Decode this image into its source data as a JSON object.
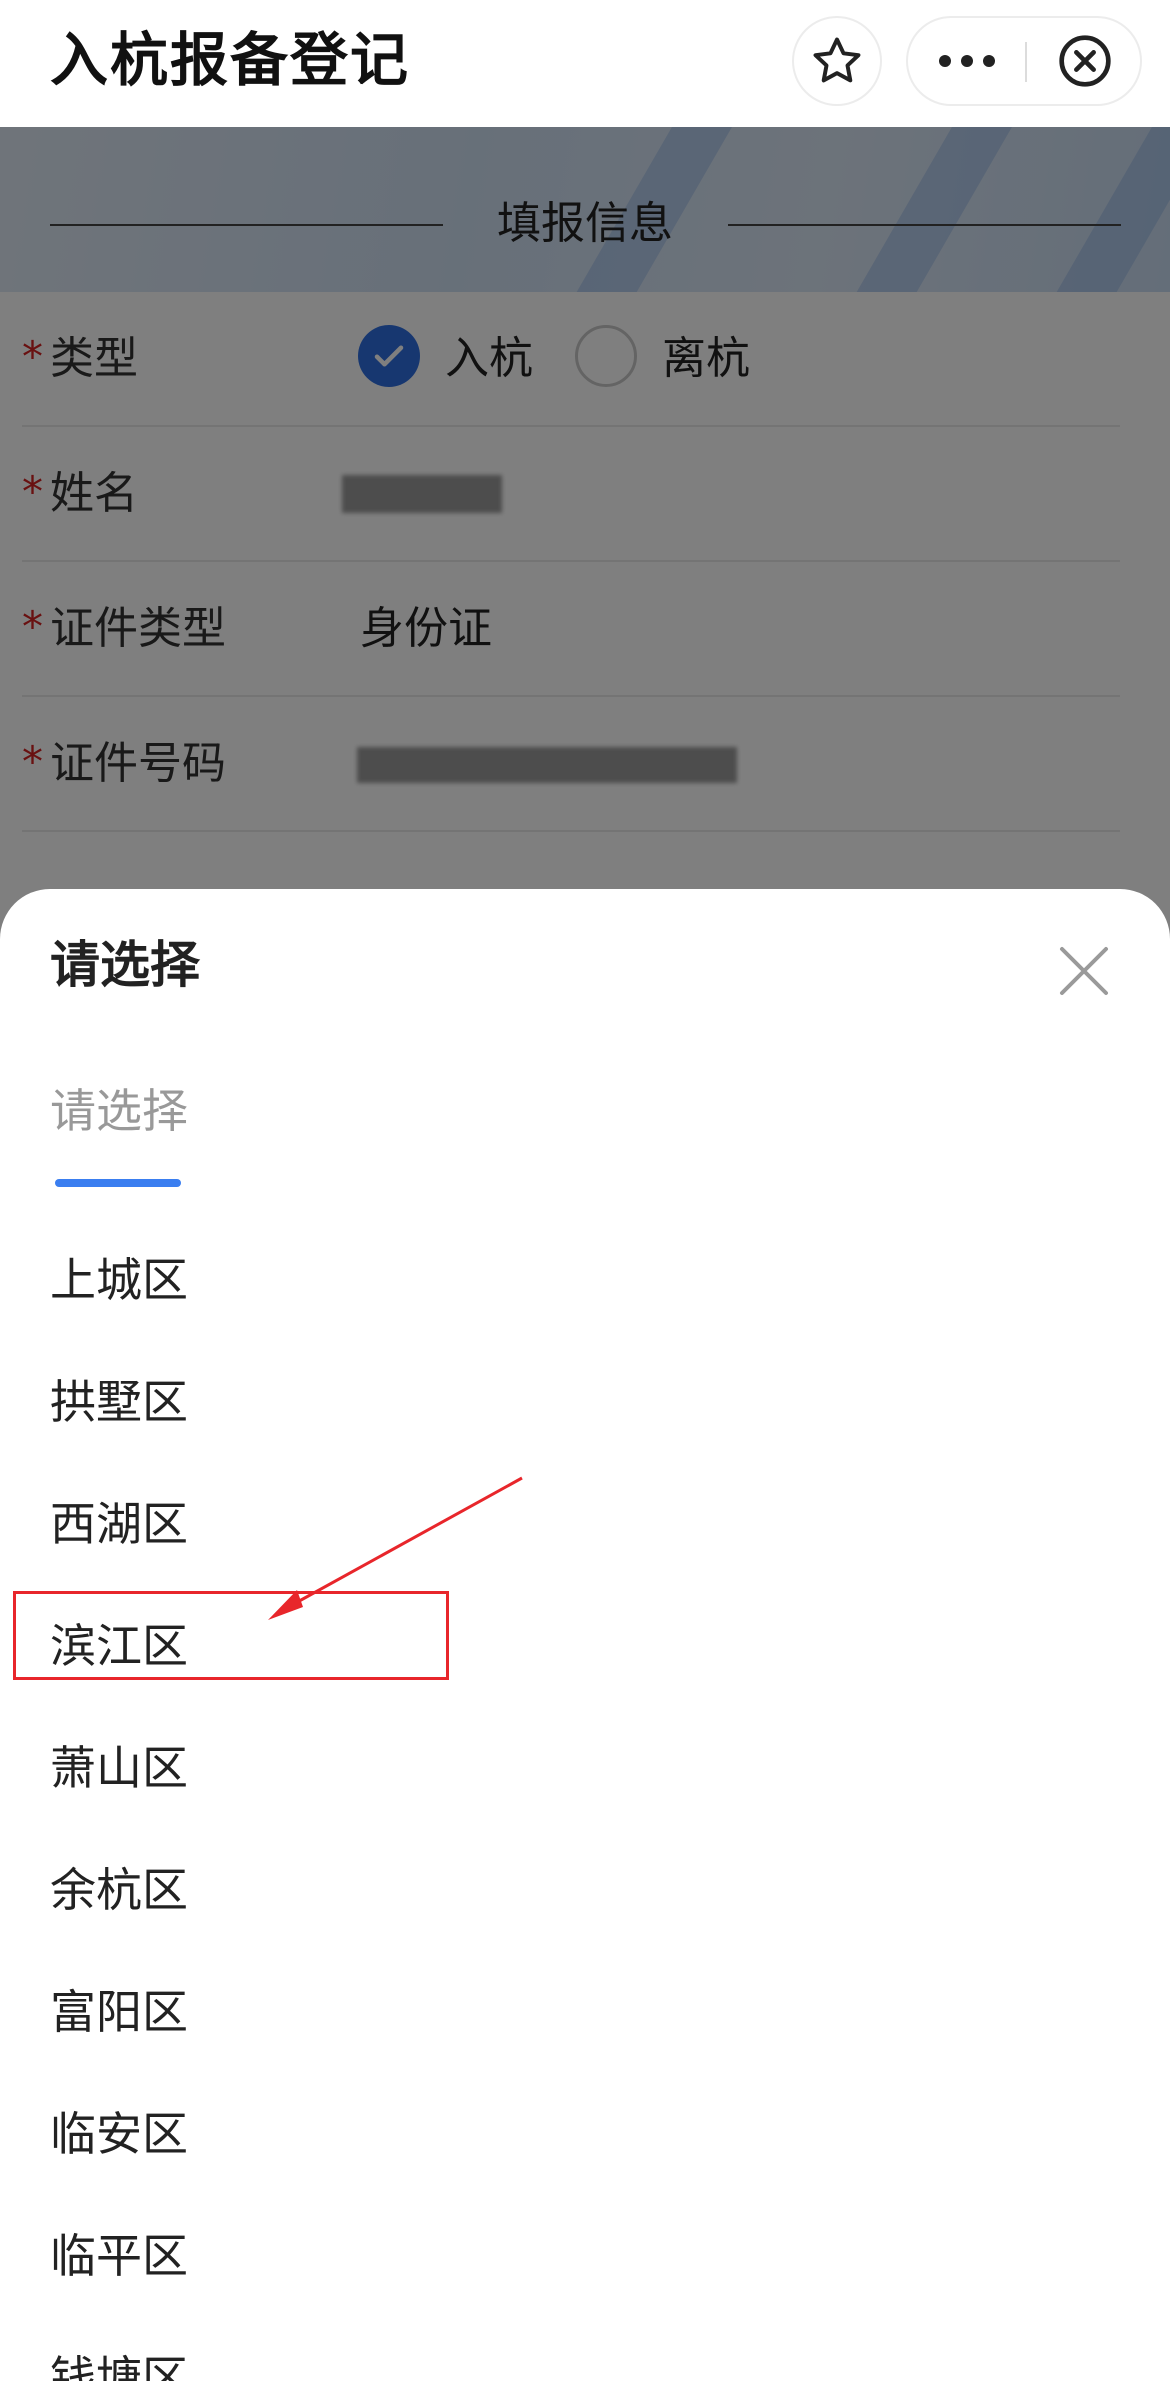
{
  "app": {
    "title": "入杭报备登记",
    "favorite_icon": "star-icon",
    "more_icon": "more-dots-icon",
    "close_icon": "circle-close-icon"
  },
  "form": {
    "section_title": "填报信息",
    "fields": [
      {
        "required": "*",
        "label": "类型",
        "options": [
          "入杭",
          "离杭"
        ],
        "selected": "入杭"
      },
      {
        "required": "*",
        "label": "姓名",
        "value": ""
      },
      {
        "required": "*",
        "label": "证件类型",
        "value": "身份证"
      },
      {
        "required": "*",
        "label": "证件号码",
        "value": ""
      }
    ]
  },
  "sheet": {
    "title": "请选择",
    "close_icon": "close-x-icon",
    "tab_label": "请选择",
    "options": [
      "上城区",
      "拱墅区",
      "西湖区",
      "滨江区",
      "萧山区",
      "余杭区",
      "富阳区",
      "临安区",
      "临平区",
      "钱塘区"
    ],
    "highlighted_option": "滨江区"
  },
  "colors": {
    "accent": "#3a7ef0",
    "radio_checked": "#2f6fe0",
    "required": "#d22222",
    "annotation": "#e8262b",
    "overlay": "rgba(0,0,0,0.5)"
  }
}
